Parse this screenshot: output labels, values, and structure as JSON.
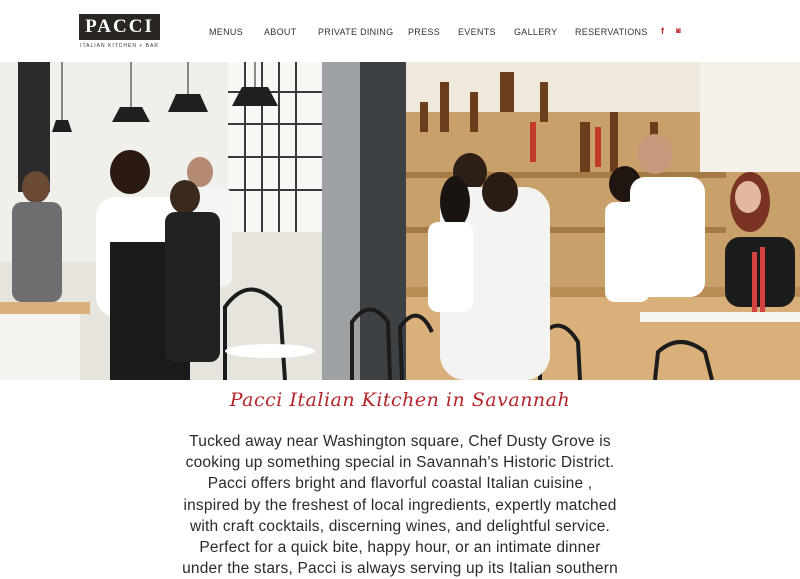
{
  "brand": {
    "name": "PACCI",
    "tagline": "ITALIAN KITCHEN + BAR"
  },
  "nav": {
    "items": [
      {
        "label": "MENUS"
      },
      {
        "label": "ABOUT"
      },
      {
        "label": "PRIVATE DINING"
      },
      {
        "label": "PRESS"
      },
      {
        "label": "EVENTS"
      },
      {
        "label": "GALLERY"
      },
      {
        "label": "RESERVATIONS"
      }
    ],
    "social": [
      {
        "icon": "facebook-icon",
        "glyph": "f"
      },
      {
        "icon": "instagram-icon",
        "glyph": "◙"
      }
    ]
  },
  "hero": {
    "image": "restaurant-bar-scene"
  },
  "content": {
    "title": "Pacci Italian Kitchen in Savannah",
    "body_lines": [
      "Tucked away near Washington square, Chef Dusty Grove is",
      "cooking up something special in Savannah's Historic District.",
      "Pacci offers bright and flavorful coastal Italian cuisine ,",
      "inspired by the freshest of local ingredients, expertly matched",
      "with craft cocktails, discerning wines, and delightful service.",
      "Perfect for a quick bite, happy hour, or an intimate dinner",
      "under the stars, Pacci is always serving up its Italian southern"
    ]
  },
  "colors": {
    "accent": "#b5242b",
    "logo_bg": "#2a2622"
  }
}
